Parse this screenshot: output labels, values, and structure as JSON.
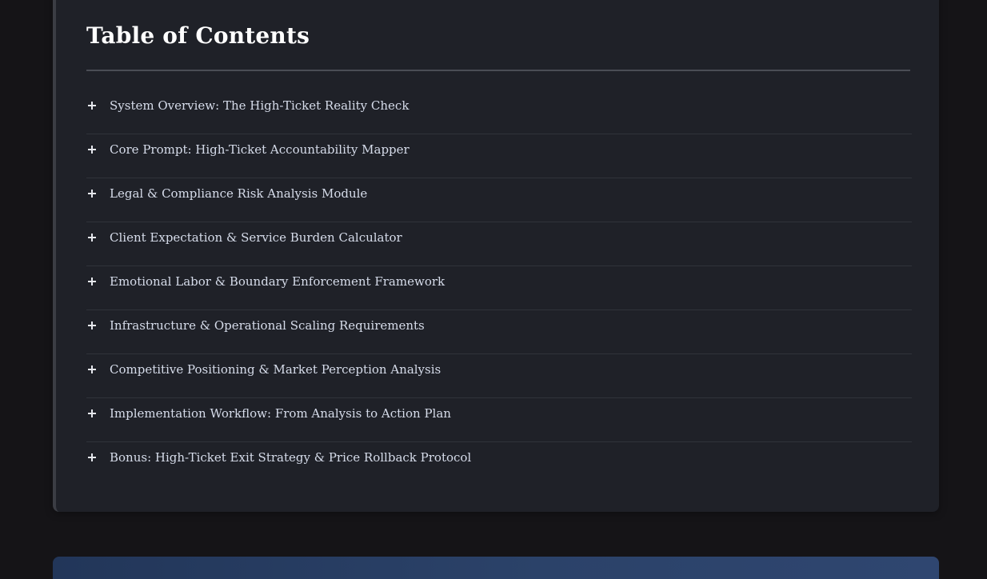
{
  "toc": {
    "title": "Table of Contents",
    "items": [
      {
        "label": "System Overview: The High-Ticket Reality Check",
        "icon": "plus-icon"
      },
      {
        "label": "Core Prompt: High-Ticket Accountability Mapper",
        "icon": "plus-icon"
      },
      {
        "label": "Legal & Compliance Risk Analysis Module",
        "icon": "plus-icon"
      },
      {
        "label": "Client Expectation & Service Burden Calculator",
        "icon": "plus-icon"
      },
      {
        "label": "Emotional Labor & Boundary Enforcement Framework",
        "icon": "plus-icon"
      },
      {
        "label": "Infrastructure & Operational Scaling Requirements",
        "icon": "plus-icon"
      },
      {
        "label": "Competitive Positioning & Market Perception Analysis",
        "icon": "plus-icon"
      },
      {
        "label": "Implementation Workflow: From Analysis to Action Plan",
        "icon": "plus-icon"
      },
      {
        "label": "Bonus: High-Ticket Exit Strategy & Price Rollback Protocol",
        "icon": "plus-icon"
      }
    ]
  },
  "colors": {
    "page_background": "#151417",
    "card_background": "#1f2128",
    "title_text": "#ffffff",
    "item_text": "#d6dcea",
    "next_section_accent": "#2b4269"
  }
}
